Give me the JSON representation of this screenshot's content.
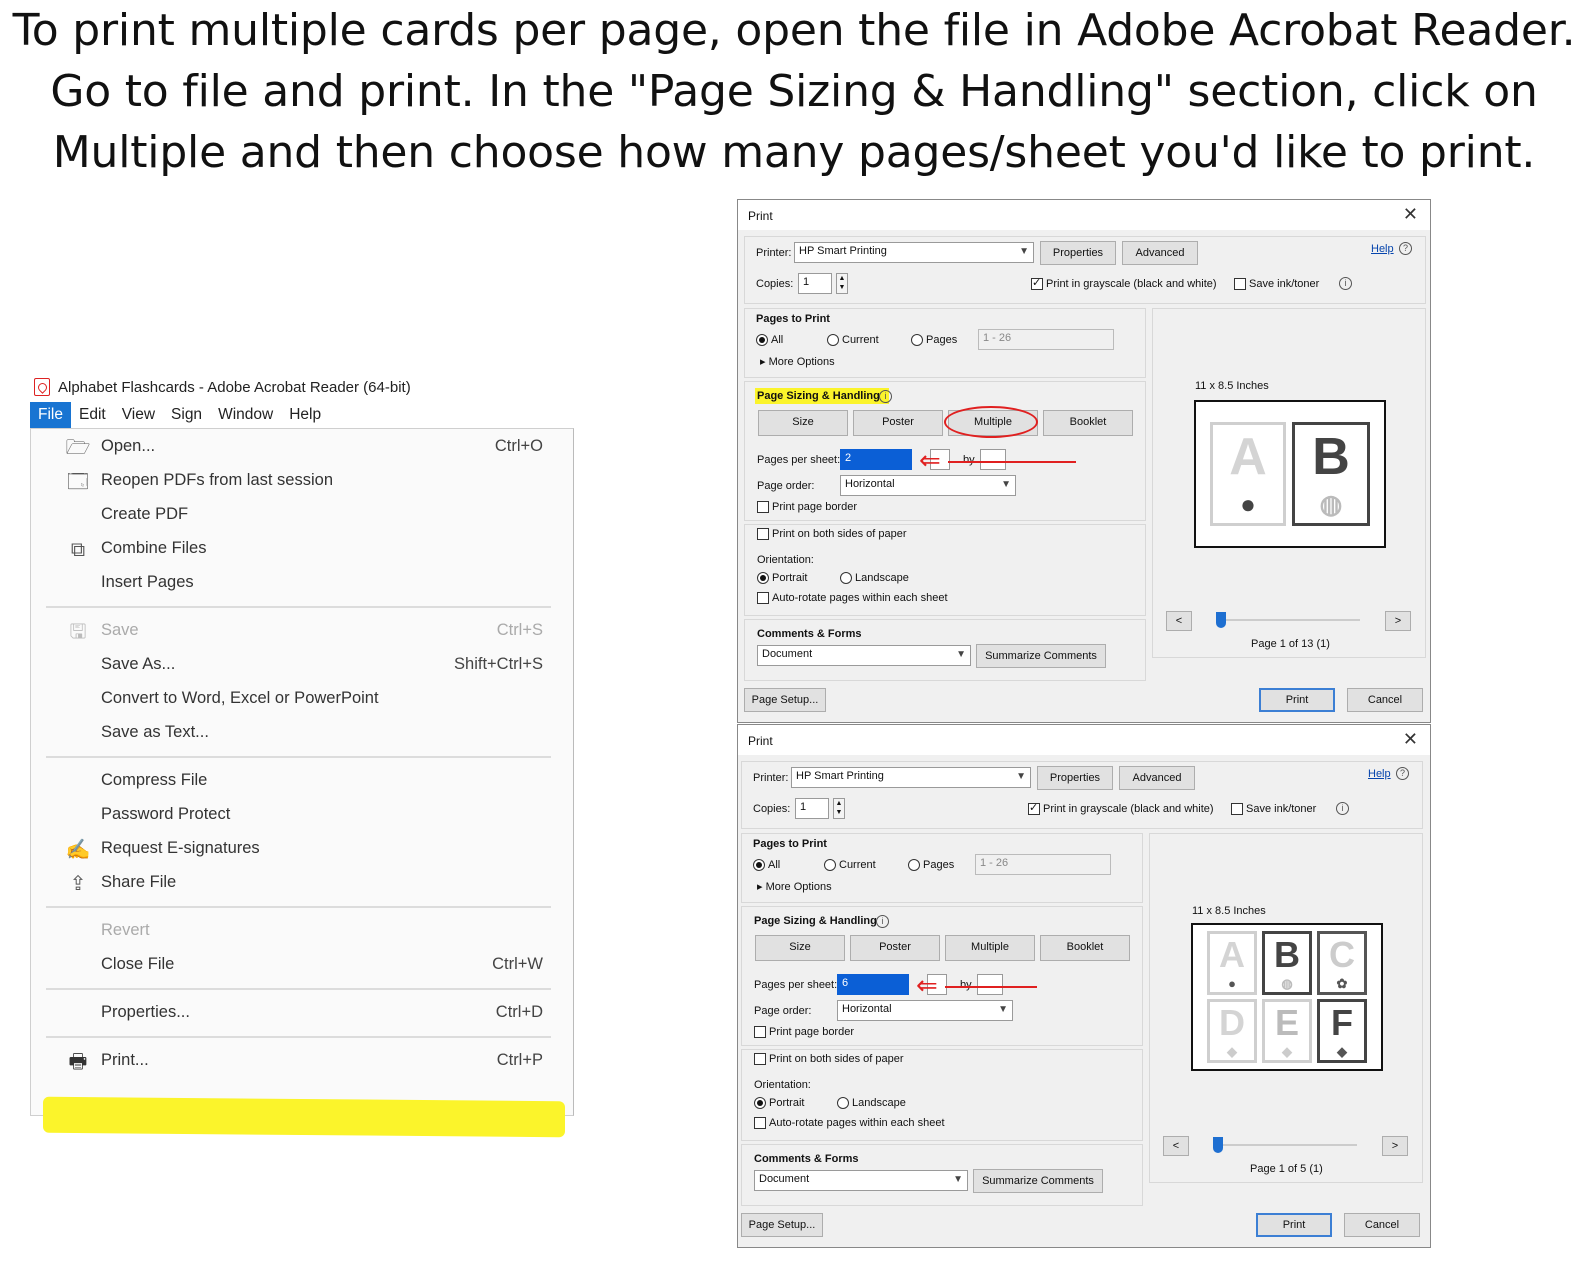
{
  "headline": {
    "line1": "To print multiple cards per page, open the file in Adobe Acrobat Reader.",
    "line2": "Go to file and print. In the \"Page Sizing & Handling\" section, click on",
    "line3": "Multiple and then choose how many pages/sheet you'd like to print."
  },
  "acrobat": {
    "title": "Alphabet Flashcards - Adobe Acrobat Reader (64-bit)",
    "menubar": [
      "File",
      "Edit",
      "View",
      "Sign",
      "Window",
      "Help"
    ],
    "file_menu": [
      {
        "label": "Open...",
        "shortcut": "Ctrl+O",
        "icon": "folder-open-icon"
      },
      {
        "label": "Reopen PDFs from last session",
        "shortcut": "",
        "icon": "reopen-icon"
      },
      {
        "label": "Create PDF",
        "shortcut": ""
      },
      {
        "label": "Combine Files",
        "shortcut": "",
        "icon": "combine-files-icon"
      },
      {
        "label": "Insert Pages",
        "shortcut": ""
      },
      {
        "label": "Save",
        "shortcut": "Ctrl+S",
        "icon": "save-icon",
        "disabled": true
      },
      {
        "label": "Save As...",
        "shortcut": "Shift+Ctrl+S"
      },
      {
        "label": "Convert to Word, Excel or PowerPoint",
        "shortcut": ""
      },
      {
        "label": "Save as Text...",
        "shortcut": ""
      },
      {
        "label": "Compress File",
        "shortcut": ""
      },
      {
        "label": "Password Protect",
        "shortcut": ""
      },
      {
        "label": "Request E-signatures",
        "shortcut": "",
        "icon": "signature-icon"
      },
      {
        "label": "Share File",
        "shortcut": "",
        "icon": "share-icon"
      },
      {
        "label": "Revert",
        "shortcut": "",
        "disabled": true
      },
      {
        "label": "Close File",
        "shortcut": "Ctrl+W"
      },
      {
        "label": "Properties...",
        "shortcut": "Ctrl+D"
      },
      {
        "label": "Print...",
        "shortcut": "Ctrl+P",
        "icon": "printer-icon"
      }
    ],
    "highlight_color": "#fbf42b"
  },
  "dialogs": [
    {
      "title": "Print",
      "printer_label": "Printer:",
      "printer": "HP Smart Printing",
      "properties": "Properties",
      "advanced": "Advanced",
      "help": "Help",
      "copies_label": "Copies:",
      "copies": "1",
      "grayscale": "Print in grayscale (black and white)",
      "grayscale_checked": true,
      "save_ink": "Save ink/toner",
      "pages_to_print": "Pages to Print",
      "all": "All",
      "current": "Current",
      "pages": "Pages",
      "page_range": "1 - 26",
      "more_options": "More Options",
      "sizing_title": "Page Sizing & Handling",
      "size": "Size",
      "poster": "Poster",
      "multiple": "Multiple",
      "booklet": "Booklet",
      "pps_label": "Pages per sheet:",
      "pps": "2",
      "by": "by",
      "order_label": "Page order:",
      "order": "Horizontal",
      "border": "Print page border",
      "both_sides": "Print on both sides of paper",
      "orientation": "Orientation:",
      "portrait": "Portrait",
      "landscape": "Landscape",
      "autorotate": "Auto-rotate pages within each sheet",
      "comments_title": "Comments & Forms",
      "comments": "Document",
      "summarize": "Summarize Comments",
      "paper": "11 x 8.5 Inches",
      "page_info": "Page 1 of 13 (1)",
      "prev": "<",
      "next": ">",
      "page_setup": "Page Setup...",
      "print": "Print",
      "cancel": "Cancel",
      "cards": [
        "A",
        "B"
      ]
    },
    {
      "title": "Print",
      "printer_label": "Printer:",
      "printer": "HP Smart Printing",
      "properties": "Properties",
      "advanced": "Advanced",
      "help": "Help",
      "copies_label": "Copies:",
      "copies": "1",
      "grayscale": "Print in grayscale (black and white)",
      "grayscale_checked": true,
      "save_ink": "Save ink/toner",
      "pages_to_print": "Pages to Print",
      "all": "All",
      "current": "Current",
      "pages": "Pages",
      "page_range": "1 - 26",
      "more_options": "More Options",
      "sizing_title": "Page Sizing & Handling",
      "size": "Size",
      "poster": "Poster",
      "multiple": "Multiple",
      "booklet": "Booklet",
      "pps_label": "Pages per sheet:",
      "pps": "6",
      "by": "by",
      "order_label": "Page order:",
      "order": "Horizontal",
      "border": "Print page border",
      "both_sides": "Print on both sides of paper",
      "orientation": "Orientation:",
      "portrait": "Portrait",
      "landscape": "Landscape",
      "autorotate": "Auto-rotate pages within each sheet",
      "comments_title": "Comments & Forms",
      "comments": "Document",
      "summarize": "Summarize Comments",
      "paper": "11 x 8.5 Inches",
      "page_info": "Page 1 of 5 (1)",
      "prev": "<",
      "next": ">",
      "page_setup": "Page Setup...",
      "print": "Print",
      "cancel": "Cancel",
      "cards": [
        "A",
        "B",
        "C",
        "D",
        "E",
        "F"
      ]
    }
  ]
}
